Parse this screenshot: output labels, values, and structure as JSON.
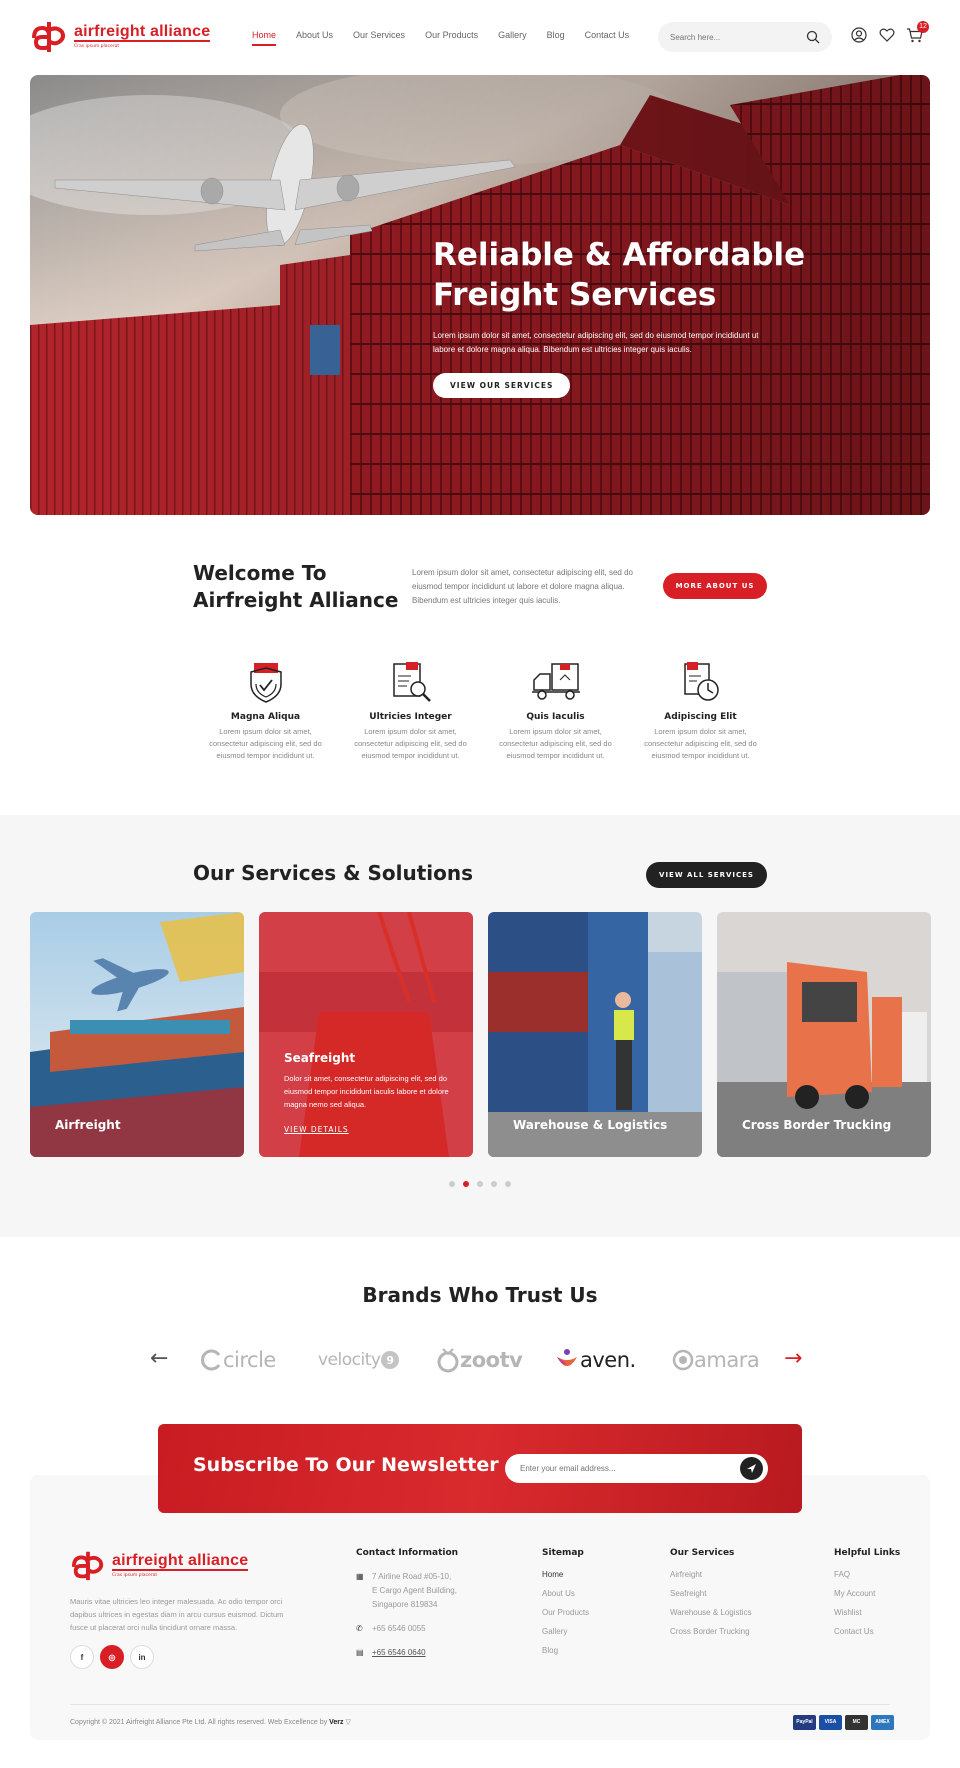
{
  "brand": {
    "name": "airfreight alliance",
    "tagline": "Cras ipsum placerat"
  },
  "nav": {
    "items": [
      "Home",
      "About Us",
      "Our Services",
      "Our Products",
      "Gallery",
      "Blog",
      "Contact Us"
    ],
    "active": "Home"
  },
  "search": {
    "placeholder": "Search here..."
  },
  "header_icons": {
    "account": "user-icon",
    "wishlist": "heart-icon",
    "cart": "cart-icon",
    "cart_count": "12"
  },
  "hero": {
    "title_line1": "Reliable & Affordable",
    "title_line2": "Freight Services",
    "subtitle": "Lorem ipsum dolor sit amet, consectetur adipiscing elit, sed do eiusmod tempor incididunt ut labore et dolore magna aliqua. Bibendum est ultricies integer quis iaculis.",
    "button": "VIEW OUR SERVICES"
  },
  "welcome": {
    "title_line1": "Welcome To",
    "title_line2": "Airfreight Alliance",
    "text": "Lorem ipsum dolor sit amet, consectetur adipiscing elit, sed do eiusmod tempor incididunt ut labore et dolore magna aliqua. Bibendum est ultricies integer quis iaculis.",
    "button": "MORE ABOUT US"
  },
  "features": [
    {
      "icon": "shield-box-icon",
      "title": "Magna Aliqua",
      "text": "Lorem ipsum dolor sit amet, consectetur adipiscing elit, sed do eiusmod tempor incididunt ut."
    },
    {
      "icon": "document-search-icon",
      "title": "Ultricies Integer",
      "text": "Lorem ipsum dolor sit amet, consectetur adipiscing elit, sed do eiusmod tempor incididunt ut."
    },
    {
      "icon": "delivery-truck-icon",
      "title": "Quis Iaculis",
      "text": "Lorem ipsum dolor sit amet, consectetur adipiscing elit, sed do eiusmod tempor incididunt ut."
    },
    {
      "icon": "clock-document-icon",
      "title": "Adipiscing Elit",
      "text": "Lorem ipsum dolor sit amet, consectetur adipiscing elit, sed do eiusmod tempor incididunt ut."
    }
  ],
  "services": {
    "title": "Our Services & Solutions",
    "button": "VIEW ALL SERVICES",
    "cards": [
      {
        "label": "Airfreight"
      },
      {
        "label": "Seafreight",
        "text": "Dolor sit amet, consectetur adipiscing elit, sed do eiusmod tempor incididunt iaculis labore et dolore magna nemo sed aliqua.",
        "link": "VIEW DETAILS"
      },
      {
        "label": "Warehouse & Logistics"
      },
      {
        "label": "Cross Border Trucking"
      }
    ],
    "slider_dots": 5,
    "active_dot": 2
  },
  "brands": {
    "title": "Brands Who Trust Us",
    "items": [
      "circle",
      "velocity",
      "zootv",
      "aven.",
      "amara"
    ],
    "prev": "←",
    "next": "→"
  },
  "newsletter": {
    "title": "Subscribe To Our Newsletter",
    "placeholder": "Enter your email address..."
  },
  "footer": {
    "about": "Mauris vitae ultricies leo integer malesuada. Ac odio tempor orci dapibus ultrices in egestas diam in arcu cursus euismod. Dictum fusce ut placerat orci nulla tincidunt ornare massa.",
    "socials": [
      "f",
      "◎",
      "in"
    ],
    "contact": {
      "title": "Contact Information",
      "address_line1": "7 Airline Road #05-10,",
      "address_line2": "E Cargo Agent Building,",
      "address_line3": "Singapore 819834",
      "phone": "+65 6546 0055",
      "fax": "+65 6546 0640"
    },
    "sitemap": {
      "title": "Sitemap",
      "links": [
        "Home",
        "About Us",
        "Our Products",
        "Gallery",
        "Blog"
      ]
    },
    "our_services": {
      "title": "Our Services",
      "links": [
        "Airfreight",
        "Seafreight",
        "Warehouse & Logistics",
        "Cross Border Trucking"
      ]
    },
    "helpful": {
      "title": "Helpful Links",
      "links": [
        "FAQ",
        "My Account",
        "Wishlist",
        "Contact Us"
      ]
    },
    "copyright": "Copyright © 2021 Airfreight Alliance Pte Ltd. All rights reserved. Web Excellence by",
    "credit": "Verz",
    "payments": [
      "PayPal",
      "VISA",
      "MC",
      "AMEX"
    ]
  },
  "colors": {
    "accent": "#d81f26",
    "dark": "#222222"
  }
}
